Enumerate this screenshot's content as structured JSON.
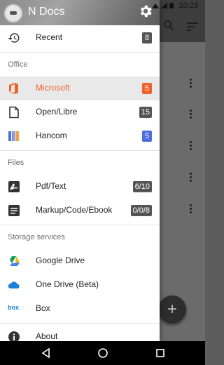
{
  "status": {
    "time": "10:23"
  },
  "drawer": {
    "title": "N Docs",
    "items": {
      "recent": {
        "label": "Recent",
        "count": "8"
      },
      "microsoft": {
        "label": "Microsoft",
        "count": "5"
      },
      "openlibre": {
        "label": "Open/Libre",
        "count": "15"
      },
      "hancom": {
        "label": "Hancom",
        "count": "5"
      },
      "pdf": {
        "label": "Pdf/Text",
        "count": "6/10"
      },
      "markup": {
        "label": "Markup/Code/Ebook",
        "count": "0/0/8"
      },
      "gdrive": {
        "label": "Google Drive"
      },
      "onedrive": {
        "label": "One Drive (Beta)"
      },
      "box": {
        "label": "Box",
        "icon_text": "box"
      },
      "about": {
        "label": "About"
      }
    },
    "sections": {
      "office": "Office",
      "files": "Files",
      "storage": "Storage services"
    }
  },
  "fab": {
    "symbol": "+"
  },
  "colors": {
    "accent": "#f0622a",
    "badge_default": "#555555",
    "badge_blue": "#4c6ee0",
    "active_row": "#e9e9e9"
  },
  "icons": {
    "recent": "history-icon",
    "microsoft": "office-icon",
    "openlibre": "document-icon",
    "hancom": "hancom-icon",
    "pdf": "pdf-icon",
    "markup": "text-document-icon",
    "gdrive": "google-drive-icon",
    "onedrive": "cloud-icon",
    "about": "info-icon",
    "settings": "gear-icon"
  }
}
